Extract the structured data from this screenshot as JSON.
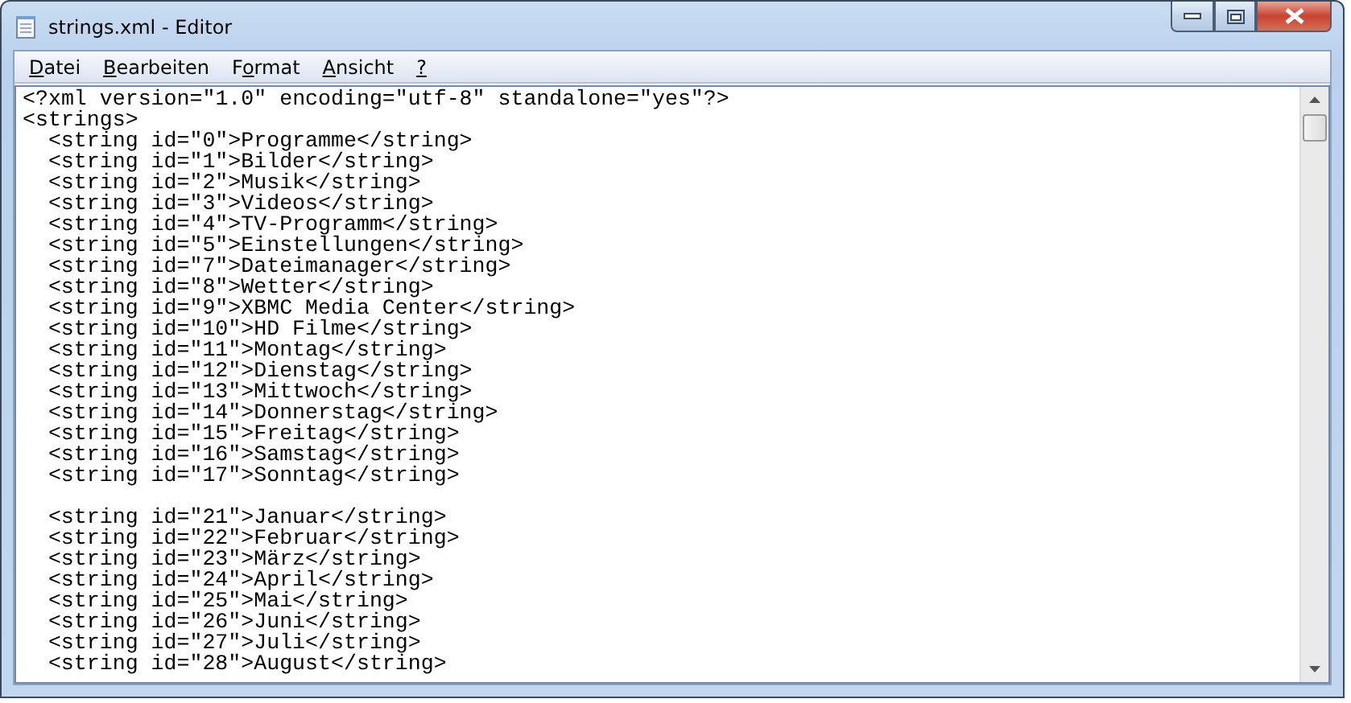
{
  "window": {
    "title": "strings.xml - Editor"
  },
  "menu": [
    {
      "mnemonic": "D",
      "rest": "atei"
    },
    {
      "mnemonic": "B",
      "rest": "earbeiten"
    },
    {
      "before": "F",
      "mnemonic": "o",
      "rest": "rmat"
    },
    {
      "mnemonic": "A",
      "rest": "nsicht"
    },
    {
      "mnemonic": "?"
    }
  ],
  "document": {
    "declaration": "<?xml version=\"1.0\" encoding=\"utf-8\" standalone=\"yes\"?>",
    "root": {
      "text": "<strings>",
      "sections": [
        {
          "lines": [
            "<string id=\"0\">Programme</string>",
            "<string id=\"1\">Bilder</string>",
            "<string id=\"2\">Musik</string>",
            "<string id=\"3\">Videos</string>",
            "<string id=\"4\">TV-Programm</string>",
            "<string id=\"5\">Einstellungen</string>",
            "<string id=\"7\">Dateimanager</string>",
            "<string id=\"8\">Wetter</string>",
            "<string id=\"9\">XBMC Media Center</string>",
            "<string id=\"10\">HD Filme</string>",
            "<string id=\"11\">Montag</string>",
            "<string id=\"12\">Dienstag</string>",
            "<string id=\"13\">Mittwoch</string>",
            "<string id=\"14\">Donnerstag</string>",
            "<string id=\"15\">Freitag</string>",
            "<string id=\"16\">Samstag</string>",
            "<string id=\"17\">Sonntag</string>"
          ]
        },
        {
          "lines": [
            "<string id=\"21\">Januar</string>",
            "<string id=\"22\">Februar</string>",
            "<string id=\"23\">März</string>",
            "<string id=\"24\">April</string>",
            "<string id=\"25\">Mai</string>",
            "<string id=\"26\">Juni</string>",
            "<string id=\"27\">Juli</string>",
            "<string id=\"28\">August</string>"
          ]
        }
      ]
    }
  }
}
